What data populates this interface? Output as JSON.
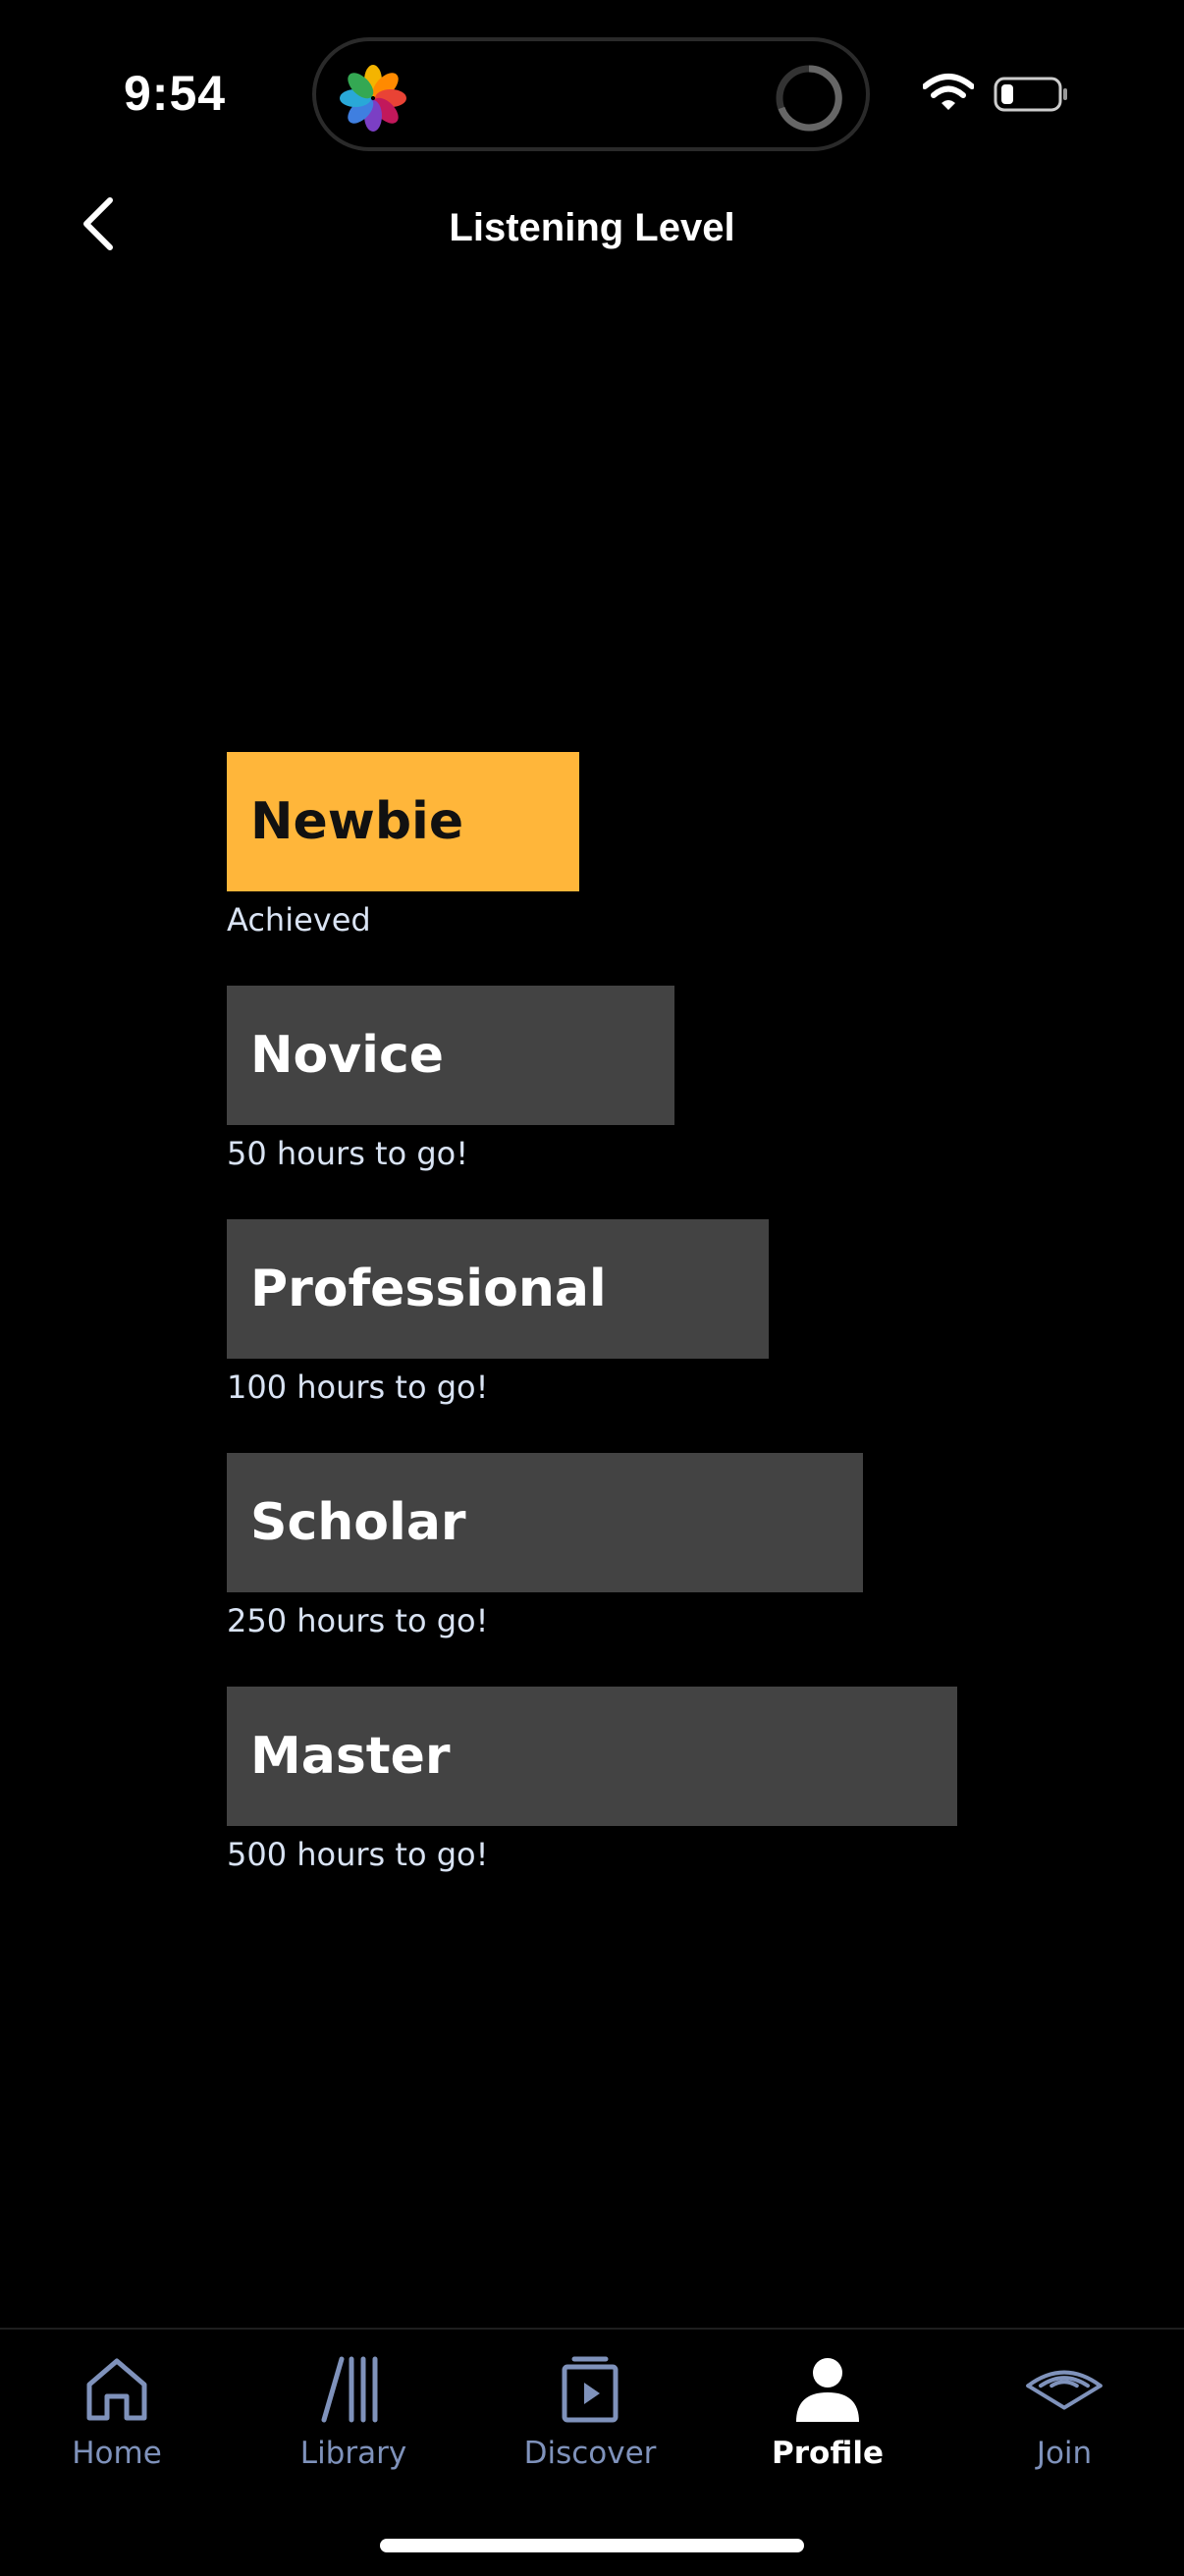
{
  "status": {
    "time": "9:54"
  },
  "header": {
    "title": "Listening Level"
  },
  "levels": [
    {
      "name": "Newbie",
      "status": "Achieved",
      "achieved": true
    },
    {
      "name": "Novice",
      "status": "50 hours to go!",
      "achieved": false
    },
    {
      "name": "Professional",
      "status": "100 hours to go!",
      "achieved": false
    },
    {
      "name": "Scholar",
      "status": "250 hours to go!",
      "achieved": false
    },
    {
      "name": "Master",
      "status": "500 hours to go!",
      "achieved": false
    }
  ],
  "tabs": [
    {
      "label": "Home",
      "icon": "home-icon"
    },
    {
      "label": "Library",
      "icon": "library-icon"
    },
    {
      "label": "Discover",
      "icon": "discover-icon"
    },
    {
      "label": "Profile",
      "icon": "profile-icon",
      "active": true
    },
    {
      "label": "Join",
      "icon": "join-icon"
    }
  ],
  "colors": {
    "achieved": "#ffb63a",
    "locked": "#434343",
    "tab_inactive": "#7f92bb"
  }
}
